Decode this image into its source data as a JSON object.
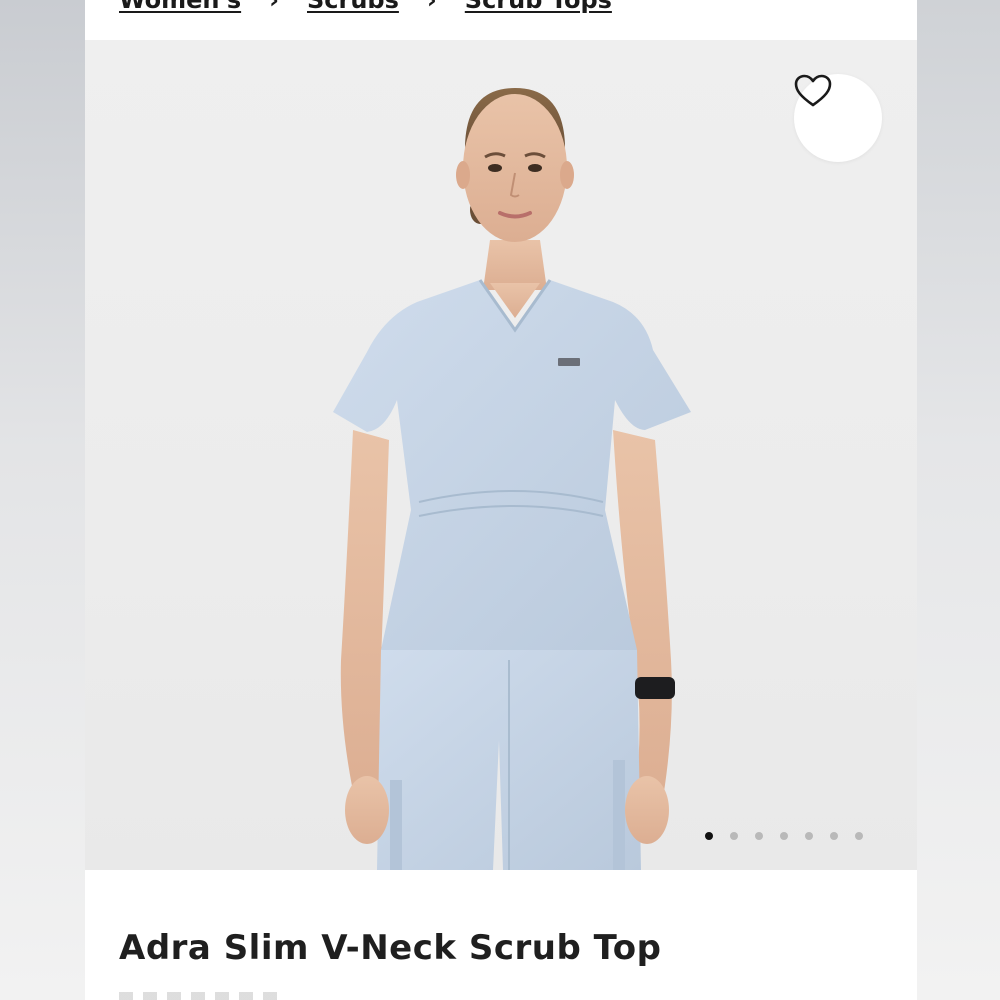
{
  "breadcrumb": {
    "items": [
      "Women's",
      "Scrubs",
      "Scrub Tops"
    ]
  },
  "product": {
    "title": "Adra Slim V-Neck Scrub Top",
    "image_alt": "Model wearing light blue slim v-neck scrub top"
  },
  "gallery": {
    "total_images": 7,
    "active_index": 0
  },
  "icons": {
    "favorite": "heart-outline-icon"
  },
  "colors": {
    "scrub": "#c5d4e6",
    "background": "#ececec",
    "dot_active": "#111111",
    "dot_inactive": "#b9b9b9"
  }
}
